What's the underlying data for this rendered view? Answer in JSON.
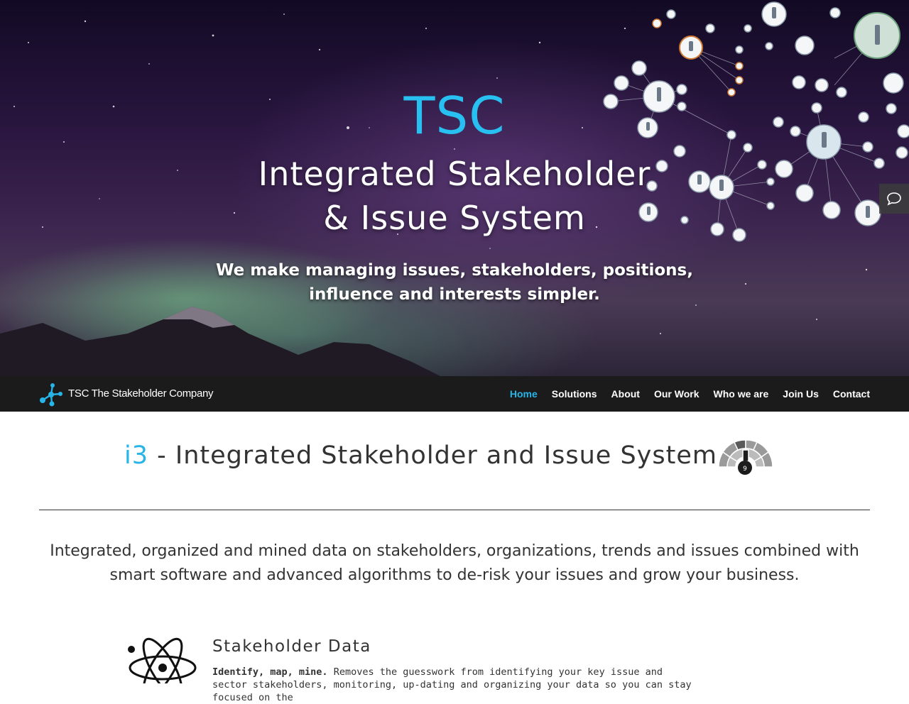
{
  "hero": {
    "brand_heading": "TSC",
    "title_line1": "Integrated Stakeholder",
    "title_line2": "& Issue System",
    "tagline": "We make managing issues, stakeholders, positions, influence and interests simpler."
  },
  "chat_button": {
    "icon": "chat-bubble-icon"
  },
  "navbar": {
    "logo_icon": "molecule-logo-icon",
    "brand_text": "TSC The Stakeholder Company",
    "items": [
      {
        "label": "Home",
        "active": true
      },
      {
        "label": "Solutions",
        "active": false
      },
      {
        "label": "About",
        "active": false
      },
      {
        "label": "Our Work",
        "active": false
      },
      {
        "label": "Who we are",
        "active": false
      },
      {
        "label": "Join Us",
        "active": false
      },
      {
        "label": "Contact",
        "active": false
      }
    ]
  },
  "section": {
    "title_accent": "i3",
    "title_rest": " - Integrated Stakeholder and Issue System",
    "gauge_value": "9",
    "lead": "Integrated, organized and mined data on stakeholders, organizations, trends and issues combined with smart software and advanced algorithms to de-risk your issues and grow your business."
  },
  "feature": {
    "icon": "atom-icon",
    "title": "Stakeholder Data",
    "lead_bold": "Identify, map, mine.",
    "text": " Removes the guesswork from identifying your key issue and sector stakeholders, monitoring, up-dating and organizing your data so you can stay focused on the"
  },
  "colors": {
    "accent": "#27b5e8",
    "navbar_bg": "#1b1b1b",
    "text": "#333333"
  }
}
